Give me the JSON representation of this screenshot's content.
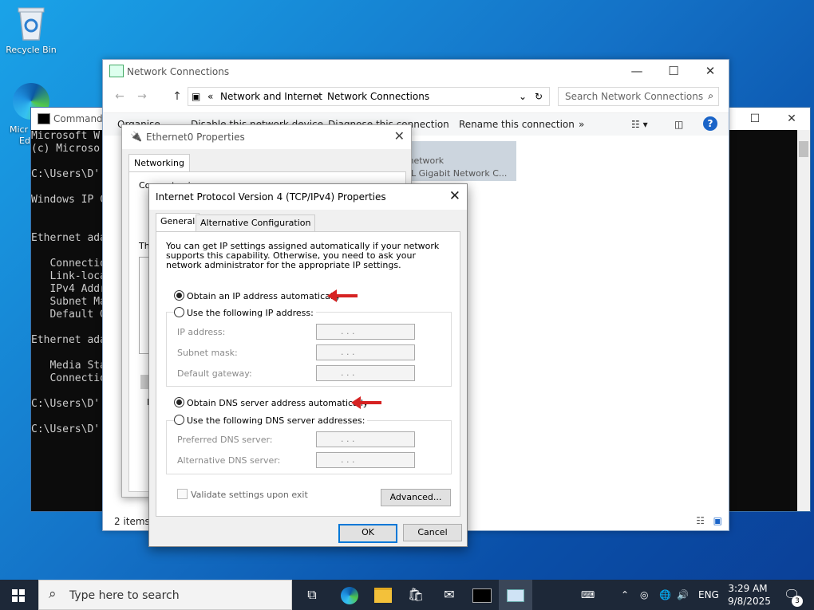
{
  "desktop": {
    "recycle_bin": "Recycle Bin",
    "edge_label_1": "Micr",
    "edge_label_2": "Ed"
  },
  "cmd": {
    "title": "Command P",
    "lines": [
      "Microsoft W",
      "(c) Microso",
      "",
      "C:\\Users\\D'",
      "",
      "Windows IP C",
      "",
      "",
      "Ethernet ada",
      "",
      "   Connectio",
      "   Link-loca",
      "   IPv4 Addr",
      "   Subnet Ma",
      "   Default G",
      "",
      "Ethernet ada",
      "",
      "   Media Sta",
      "   Connectio",
      "",
      "C:\\Users\\D'",
      "",
      "C:\\Users\\D'"
    ]
  },
  "network_window": {
    "title": "Network Connections",
    "breadcrumb": [
      "Network and Internet",
      "Network Connections"
    ],
    "breadcrumb_prefix": "«",
    "search_placeholder": "Search Network Connections",
    "commands": {
      "organise": "Organise",
      "disable": "Disable this network device",
      "diagnose": "Diagnose this connection",
      "rename": "Rename this connection",
      "more": "»"
    },
    "adapter_line1": "d network",
    "adapter_line2": "74L Gigabit Network C...",
    "status": "2 items"
  },
  "ethernet_dialog": {
    "title": "Ethernet0 Properties",
    "tab": "Networking",
    "connect_using": "Connect using:",
    "this_conn": "Th",
    "desc": "D"
  },
  "ipv4_dialog": {
    "title": "Internet Protocol Version 4 (TCP/IPv4) Properties",
    "tabs": [
      "General",
      "Alternative Configuration"
    ],
    "intro": "You can get IP settings assigned automatically if your network supports this capability. Otherwise, you need to ask your network administrator for the appropriate IP settings.",
    "obtain_ip_auto": "Obtain an IP address automatically",
    "use_following_ip": "Use the following IP address:",
    "ip_address": "IP address:",
    "subnet_mask": "Subnet mask:",
    "default_gateway": "Default gateway:",
    "obtain_dns_auto": "Obtain DNS server address automatically",
    "use_following_dns": "Use the following DNS server addresses:",
    "preferred_dns": "Preferred DNS server:",
    "alternative_dns": "Alternative DNS server:",
    "validate": "Validate settings upon exit",
    "advanced": "Advanced...",
    "ok": "OK",
    "cancel": "Cancel",
    "ip_dots": ".        .        ."
  },
  "taskbar": {
    "search_placeholder": "Type here to search",
    "language": "ENG",
    "time": "3:29 AM",
    "date": "9/8/2025",
    "notification_count": "3"
  },
  "colors": {
    "accent": "#0078d7",
    "arrow": "#d62222",
    "taskbar": "#1d2838"
  }
}
